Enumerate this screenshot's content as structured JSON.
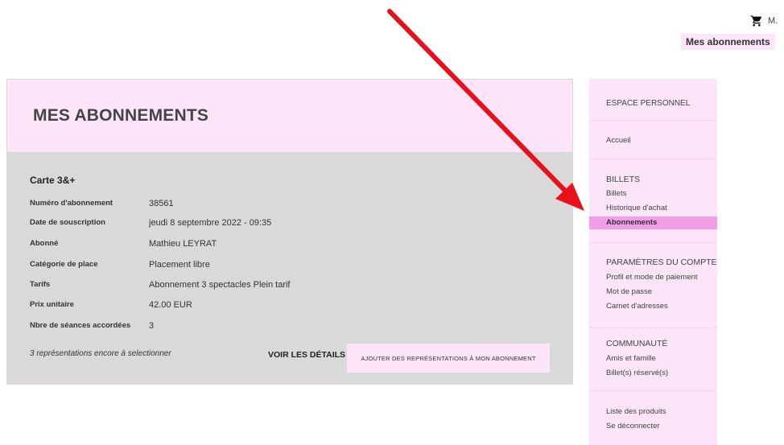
{
  "header": {
    "cart_icon": "cart-icon",
    "user_label": "M.",
    "top_link": "Mes abonnements"
  },
  "card": {
    "title": "MES ABONNEMENTS",
    "subscription_name": "Carte 3&+",
    "fields": [
      {
        "label": "Numéro d'abonnement",
        "value": "38561"
      },
      {
        "label": "Date de souscription",
        "value": "jeudi 8 septembre 2022 - 09:35"
      },
      {
        "label": "Abonné",
        "value": "Mathieu LEYRAT"
      },
      {
        "label": "Catégorie de place",
        "value": "Placement libre"
      },
      {
        "label": "Tarifs",
        "value": "Abonnement 3 spectacles Plein tarif"
      },
      {
        "label": "Prix unitaire",
        "value": "42.00 EUR"
      },
      {
        "label": "Nbre de séances accordées",
        "value": "3"
      }
    ],
    "remaining": "3 représentations encore à selectionner",
    "details_label": "VOIR LES DÉTAILS",
    "add_label": "AJOUTER DES REPRÉSENTATIONS À MON ABONNEMENT"
  },
  "sidebar": {
    "heading": "ESPACE PERSONNEL",
    "home": "Accueil",
    "billets_heading": "BILLETS",
    "billets": "Billets",
    "history": "Historique d'achat",
    "subscriptions": "Abonnements",
    "settings_heading": "PARAMÈTRES DU COMPTE",
    "profile": "Profil et mode de paiement",
    "password": "Mot de passe",
    "addresses": "Carnet d'adresses",
    "community_heading": "COMMUNAUTÉ",
    "friends": "Amis et famille",
    "reserved": "Billet(s) réservé(s)",
    "products": "Liste des produits",
    "logout": "Se déconnecter"
  },
  "colors": {
    "pink_light": "#fce4f9",
    "pink_active": "#f19ee6",
    "card_gray": "#d9d9d9",
    "arrow_red": "#e8101a"
  }
}
